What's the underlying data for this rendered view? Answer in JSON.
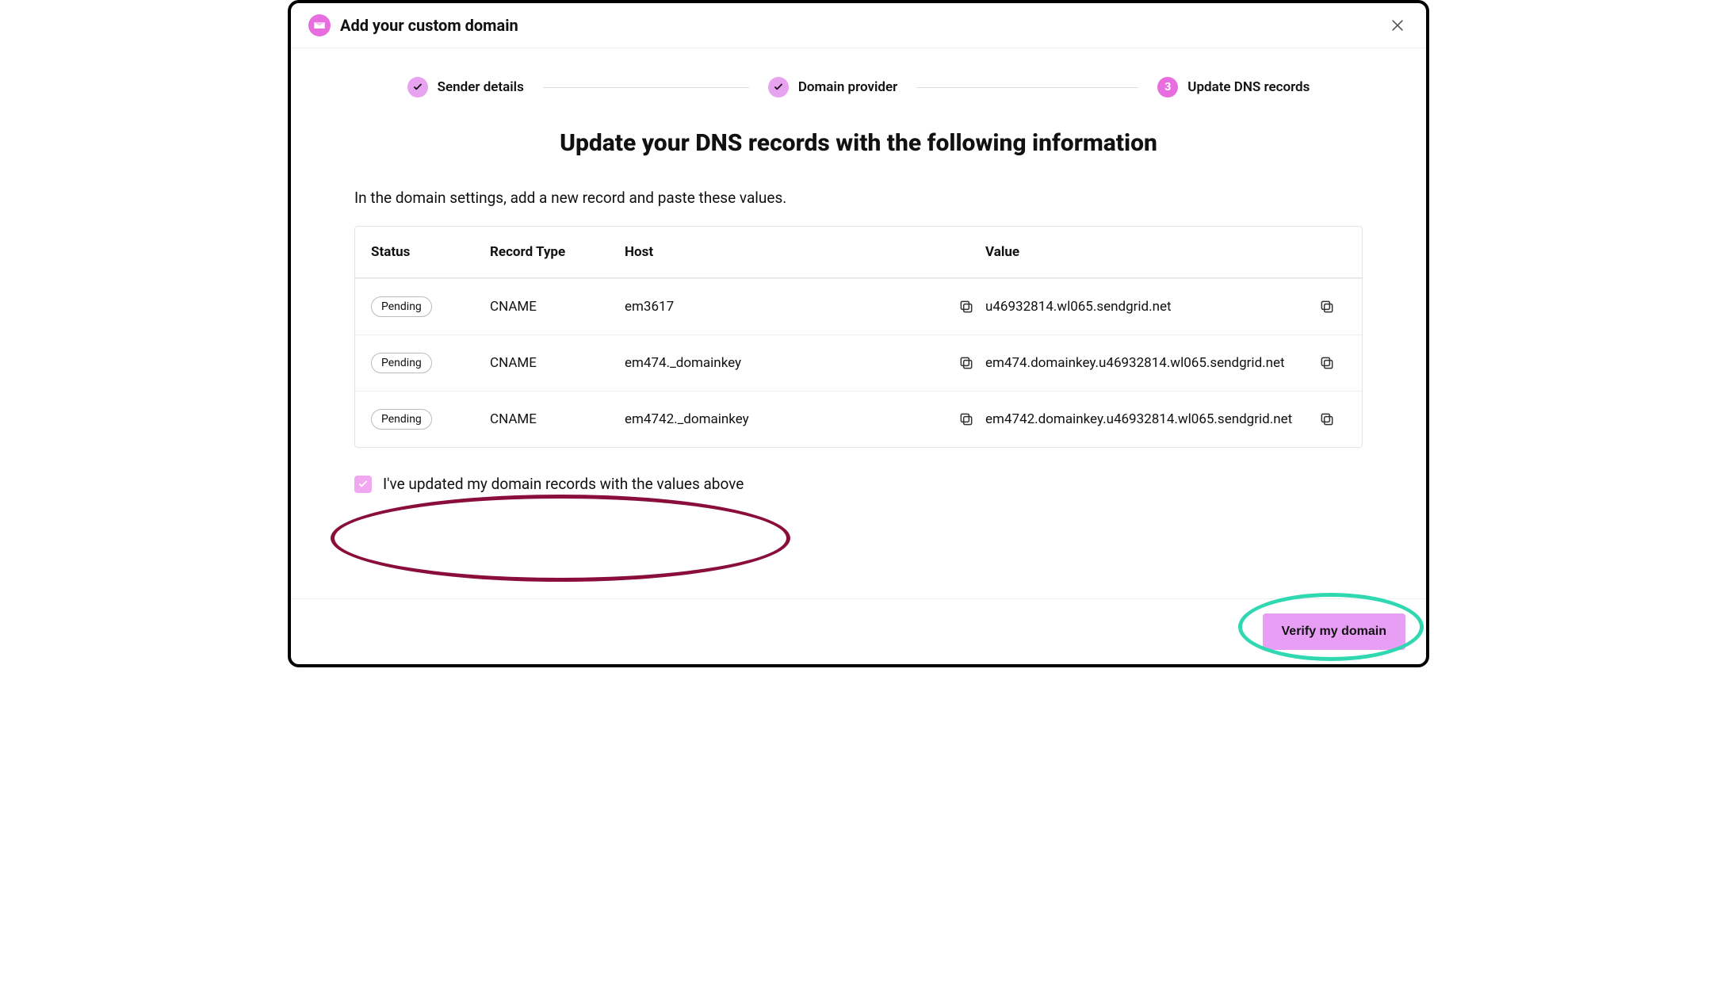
{
  "header": {
    "title": "Add your custom domain"
  },
  "stepper": {
    "steps": [
      {
        "label": "Sender details",
        "done": true
      },
      {
        "label": "Domain provider",
        "done": true
      },
      {
        "label": "Update DNS records",
        "num": "3"
      }
    ]
  },
  "page": {
    "title": "Update your DNS records with the following information",
    "instruction": "In the domain settings, add a new record and paste these values."
  },
  "table": {
    "headers": {
      "status": "Status",
      "type": "Record Type",
      "host": "Host",
      "value": "Value"
    },
    "rows": [
      {
        "status": "Pending",
        "type": "CNAME",
        "host": "em3617",
        "value": "u46932814.wl065.sendgrid.net"
      },
      {
        "status": "Pending",
        "type": "CNAME",
        "host": "em474._domainkey",
        "value": "em474.domainkey.u46932814.wl065.sendgrid.net"
      },
      {
        "status": "Pending",
        "type": "CNAME",
        "host": "em4742._domainkey",
        "value": "em4742.domainkey.u46932814.wl065.sendgrid.net"
      }
    ]
  },
  "confirm": {
    "label": "I've updated my domain records with the values above",
    "checked": true
  },
  "footer": {
    "verify_label": "Verify my domain"
  }
}
